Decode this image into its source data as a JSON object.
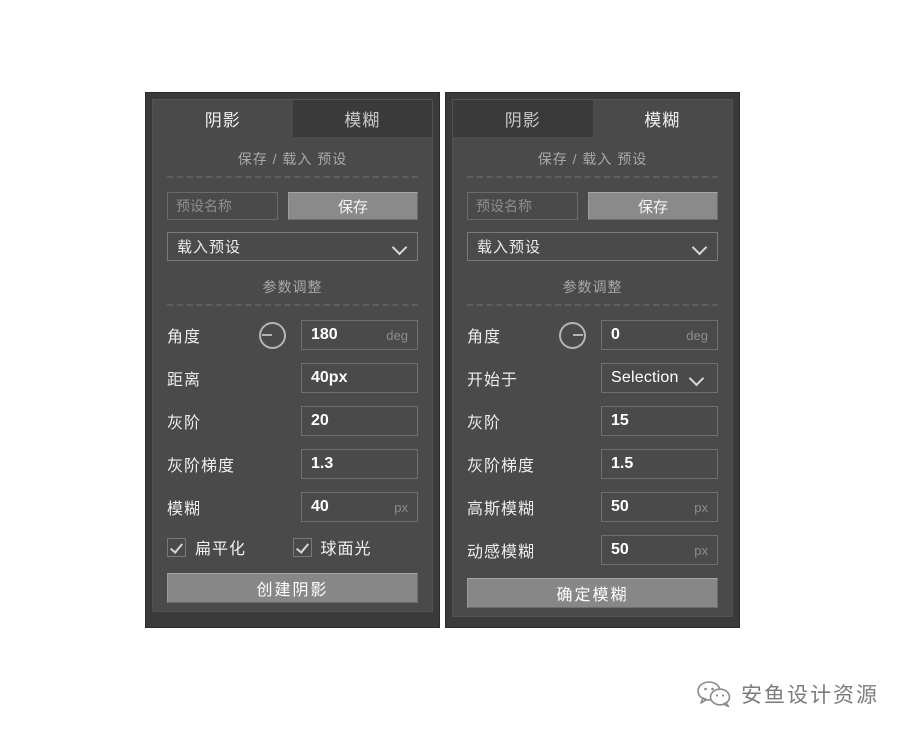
{
  "panels": [
    {
      "id": "shadow-panel",
      "tabs": [
        {
          "label": "阴影",
          "active": true
        },
        {
          "label": "模糊",
          "active": false
        }
      ],
      "preset_section": {
        "title": "保存 / 载入 预设",
        "name_placeholder": "预设名称",
        "save_label": "保存",
        "load_label": "载入预设"
      },
      "params_section": {
        "title": "参数调整",
        "rows": [
          {
            "label": "角度",
            "value": "180",
            "unit": "deg",
            "dial": "180",
            "type": "number"
          },
          {
            "label": "距离",
            "value": "40px",
            "unit": "",
            "dial": "",
            "type": "number"
          },
          {
            "label": "灰阶",
            "value": "20",
            "unit": "",
            "dial": "",
            "type": "number"
          },
          {
            "label": "灰阶梯度",
            "value": "1.3",
            "unit": "",
            "dial": "",
            "type": "number"
          },
          {
            "label": "模糊",
            "value": "40",
            "unit": "px",
            "dial": "",
            "type": "number"
          }
        ]
      },
      "checkboxes": [
        {
          "label": "扁平化",
          "checked": true
        },
        {
          "label": "球面光",
          "checked": true
        }
      ],
      "action_label": "创建阴影"
    },
    {
      "id": "blur-panel",
      "tabs": [
        {
          "label": "阴影",
          "active": false
        },
        {
          "label": "模糊",
          "active": true
        }
      ],
      "preset_section": {
        "title": "保存 / 载入 预设",
        "name_placeholder": "预设名称",
        "save_label": "保存",
        "load_label": "载入预设"
      },
      "params_section": {
        "title": "参数调整",
        "rows": [
          {
            "label": "角度",
            "value": "0",
            "unit": "deg",
            "dial": "0",
            "type": "number"
          },
          {
            "label": "开始于",
            "value": "Selection",
            "unit": "",
            "dial": "",
            "type": "select"
          },
          {
            "label": "灰阶",
            "value": "15",
            "unit": "",
            "dial": "",
            "type": "number"
          },
          {
            "label": "灰阶梯度",
            "value": "1.5",
            "unit": "",
            "dial": "",
            "type": "number"
          },
          {
            "label": "高斯模糊",
            "value": "50",
            "unit": "px",
            "dial": "",
            "type": "number"
          },
          {
            "label": "动感模糊",
            "value": "50",
            "unit": "px",
            "dial": "",
            "type": "number"
          }
        ]
      },
      "checkboxes": [],
      "action_label": "确定模糊"
    }
  ],
  "watermark": {
    "icon": "wechat-icon",
    "text": "安鱼设计资源"
  },
  "colors": {
    "panel_bg": "#4a4a4a",
    "frame_bg": "#3a3a3a",
    "text": "#ececec",
    "muted": "#8d8d8d",
    "button": "#878787"
  }
}
